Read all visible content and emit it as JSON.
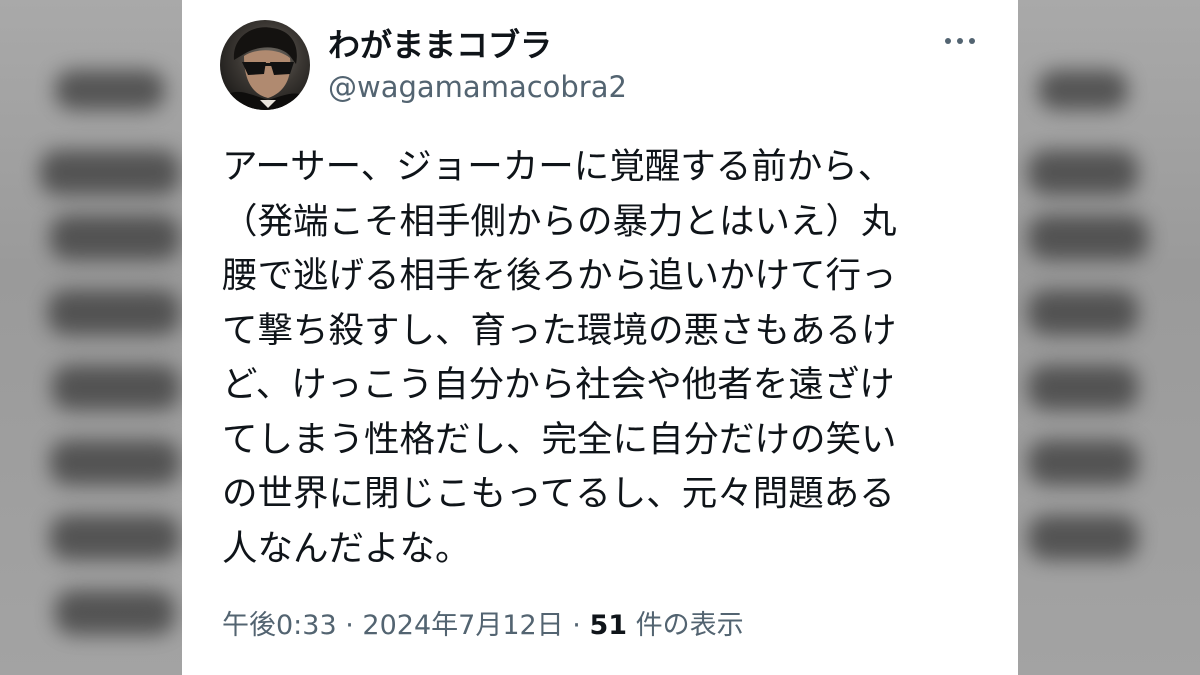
{
  "tweet": {
    "display_name": "わがままコブラ",
    "handle": "@wagamamacobra2",
    "more_icon": "more-horizontal-icon",
    "body_lines": [
      "アーサー、ジョーカーに覚醒する前から、",
      "（発端こそ相手側からの暴力とはいえ）丸",
      "腰で逃げる相手を後ろから追いかけて行っ",
      "て撃ち殺すし、育った環境の悪さもあるけ",
      "ど、けっこう自分から社会や他者を遠ざけ",
      "てしまう性格だし、完全に自分だけの笑い",
      "の世界に閉じこもってるし、元々問題ある",
      "人なんだよな。"
    ],
    "meta": {
      "time": "午後0:33",
      "separator": "·",
      "date": "2024年7月12日",
      "views_count": "51",
      "views_label": "件の表示"
    }
  },
  "colors": {
    "text_primary": "#0f1419",
    "text_secondary": "#536471",
    "card_background": "#ffffff"
  }
}
